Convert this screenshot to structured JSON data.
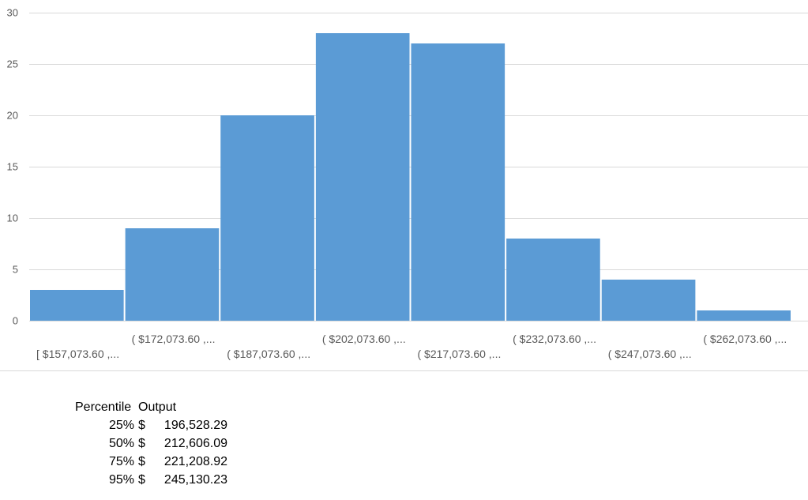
{
  "chart_data": {
    "type": "bar",
    "categories": [
      "[ $157,073.60 ,...",
      "( $172,073.60 ,...",
      "( $187,073.60 ,...",
      "( $202,073.60 ,...",
      "( $217,073.60 ,...",
      "( $232,073.60 ,...",
      "( $247,073.60 ,...",
      "( $262,073.60 ,..."
    ],
    "values": [
      3,
      9,
      20,
      28,
      27,
      8,
      4,
      1
    ],
    "ylim": [
      0,
      30
    ],
    "yticks": [
      0,
      5,
      10,
      15,
      20,
      25,
      30
    ],
    "grid": true,
    "legend": "none",
    "bar_color": "#5b9bd5",
    "gridline_color": "#d9d9d9",
    "label_color": "#595959"
  },
  "percentile_table": {
    "header_percentile": "Percentile",
    "header_output": "Output",
    "rows": [
      {
        "pct": "25%",
        "currency": "$",
        "value": "196,528.29"
      },
      {
        "pct": "50%",
        "currency": "$",
        "value": "212,606.09"
      },
      {
        "pct": "75%",
        "currency": "$",
        "value": "221,208.92"
      },
      {
        "pct": "95%",
        "currency": "$",
        "value": "245,130.23"
      }
    ]
  }
}
